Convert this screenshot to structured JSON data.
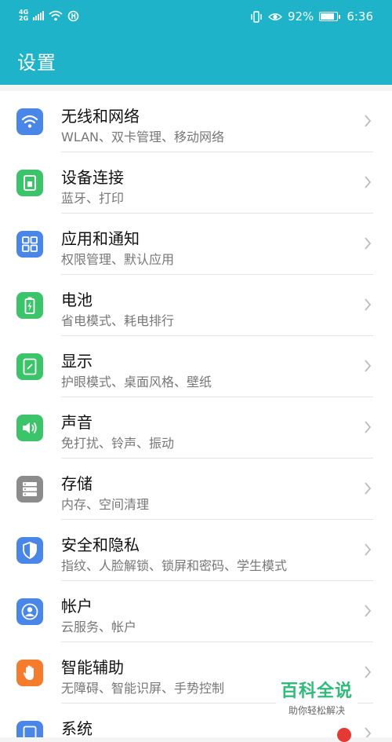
{
  "status_bar": {
    "network_type_top": "4G",
    "network_type_bottom": "2G",
    "battery_percent": "92%",
    "battery_level": 0.92,
    "time": "6:36"
  },
  "header": {
    "title": "设置",
    "background_color": "#1fb3c9"
  },
  "settings": [
    {
      "id": "wireless",
      "title": "无线和网络",
      "subtitle": "WLAN、双卡管理、移动网络",
      "icon": "wifi-icon",
      "color": "#4a86e8"
    },
    {
      "id": "device-connect",
      "title": "设备连接",
      "subtitle": "蓝牙、打印",
      "icon": "device-connect-icon",
      "color": "#3cc46a"
    },
    {
      "id": "apps",
      "title": "应用和通知",
      "subtitle": "权限管理、默认应用",
      "icon": "apps-grid-icon",
      "color": "#4a86e8"
    },
    {
      "id": "battery",
      "title": "电池",
      "subtitle": "省电模式、耗电排行",
      "icon": "battery-icon",
      "color": "#3cc46a"
    },
    {
      "id": "display",
      "title": "显示",
      "subtitle": "护眼模式、桌面风格、壁纸",
      "icon": "display-icon",
      "color": "#3cc46a"
    },
    {
      "id": "sound",
      "title": "声音",
      "subtitle": "免打扰、铃声、振动",
      "icon": "speaker-icon",
      "color": "#3cc46a"
    },
    {
      "id": "storage",
      "title": "存储",
      "subtitle": "内存、空间清理",
      "icon": "storage-icon",
      "color": "#8c8c8c"
    },
    {
      "id": "security",
      "title": "安全和隐私",
      "subtitle": "指纹、人脸解锁、锁屏和密码、学生模式",
      "icon": "shield-icon",
      "color": "#4a86e8"
    },
    {
      "id": "account",
      "title": "帐户",
      "subtitle": "云服务、帐户",
      "icon": "user-icon",
      "color": "#4a86e8"
    },
    {
      "id": "accessibility",
      "title": "智能辅助",
      "subtitle": "无障碍、智能识屏、手势控制",
      "icon": "hand-icon",
      "color": "#f57c2c"
    },
    {
      "id": "system",
      "title": "系统",
      "subtitle": "",
      "icon": "system-icon",
      "color": "#4a86e8"
    }
  ],
  "watermark": {
    "main": "百科全说",
    "sub": "助你轻松解决"
  }
}
